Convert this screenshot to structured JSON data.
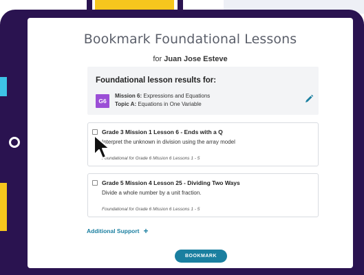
{
  "modal": {
    "title": "Bookmark Foundational Lessons",
    "subtitle_prefix": "for",
    "student_name": "Juan Jose Esteve"
  },
  "results": {
    "heading": "Foundational lesson results for:",
    "grade_badge": "G6",
    "mission_label": "Mission 6:",
    "mission_value": "Expressions and Equations",
    "topic_label": "Topic A:",
    "topic_value": "Equations in One Variable",
    "edit_icon": "pencil-icon"
  },
  "lessons": [
    {
      "title": "Grade 3 Mission 1 Lesson 6 - Ends with a Q",
      "description": "Interpret the unknown in division using the array model",
      "footer": "Foundational for Grade 6 Mission 6 Lessons 1 - 5",
      "checked": false
    },
    {
      "title": "Grade 5 Mission 4 Lesson 25 - Dividing Two Ways",
      "description": "Divide a whole number by a unit fraction.",
      "footer": "Foundational for Grade 6 Mission 6 Lessons 1 - 5",
      "checked": false
    }
  ],
  "additional_support": {
    "label": "Additional Support",
    "icon": "plus-icon"
  },
  "actions": {
    "bookmark_label": "BOOKMARK"
  },
  "colors": {
    "frame": "#2a1350",
    "accent": "#1a7fa0",
    "grade_badge": "#9b4ed6",
    "card_background": "#f3f4f6"
  }
}
